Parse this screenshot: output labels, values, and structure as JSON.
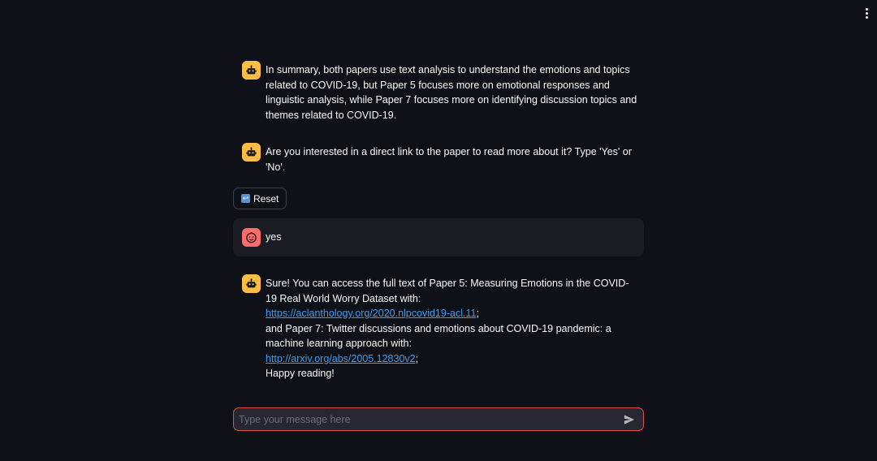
{
  "menu": {
    "icon": "more-vertical-icon"
  },
  "messages": [
    {
      "role": "assistant",
      "avatar_icon": "robot-icon",
      "lines": [
        "In summary, both papers use text analysis to understand the emotions and topics related to COVID-19, but Paper 5 focuses more on emotional responses and linguistic analysis, while Paper 7 focuses more on identifying discussion topics and themes related to COVID-19."
      ]
    },
    {
      "role": "assistant",
      "avatar_icon": "robot-icon",
      "lines": [
        "Are you interested in a direct link to the paper to read more about it? Type 'Yes' or 'No'."
      ]
    },
    {
      "role": "user",
      "avatar_icon": "smiley-face-icon",
      "lines": [
        "yes"
      ]
    },
    {
      "role": "assistant",
      "avatar_icon": "robot-icon",
      "intro_1": "Sure! You can access the full text of Paper 5: Measuring Emotions in the COVID-19 Real World Worry Dataset with:",
      "link_1": "https://aclanthology.org/2020.nlpcovid19-acl.11",
      "link_1_suffix": ";",
      "intro_2": "and Paper 7: Twitter discussions and emotions about COVID-19 pandemic: a machine learning approach with:",
      "link_2": "http://arxiv.org/abs/2005.12830v2",
      "link_2_suffix": ";",
      "outro": "Happy reading!"
    }
  ],
  "reset_button": {
    "label": "Reset",
    "icon": "reset-arrow-icon"
  },
  "chat_input": {
    "placeholder": "Type your message here",
    "value": ""
  },
  "send_button": {
    "icon": "send-icon"
  },
  "colors": {
    "background": "#0e1117",
    "bot_avatar": "#ffbd45",
    "user_avatar": "#ff6c6c",
    "user_bubble": "#1a1c24",
    "link": "#3c9df0",
    "input_border_focus": "#e04c4c"
  }
}
